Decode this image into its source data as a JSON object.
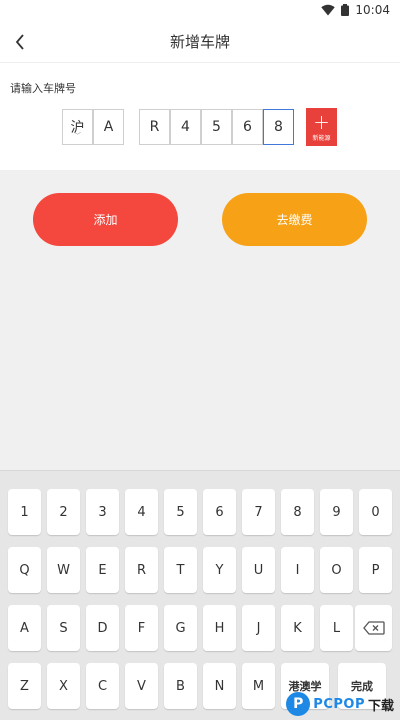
{
  "status_bar": {
    "time": "10:04"
  },
  "nav": {
    "title": "新增车牌"
  },
  "plate": {
    "prompt": "请输入车牌号",
    "province": "沪",
    "cells": [
      "A",
      "R",
      "4",
      "5",
      "6",
      "8"
    ],
    "new_energy_plus": "+",
    "new_energy_label": "新能源"
  },
  "actions": {
    "add_label": "添加",
    "pay_label": "去缴费"
  },
  "keyboard": {
    "row1": [
      "1",
      "2",
      "3",
      "4",
      "5",
      "6",
      "7",
      "8",
      "9",
      "0"
    ],
    "row2": [
      "Q",
      "W",
      "E",
      "R",
      "T",
      "Y",
      "U",
      "I",
      "O",
      "P"
    ],
    "row3": [
      "A",
      "S",
      "D",
      "F",
      "G",
      "H",
      "J",
      "K",
      "L"
    ],
    "row4": [
      "Z",
      "X",
      "C",
      "V",
      "B",
      "N",
      "M"
    ],
    "mode_label": "港澳学",
    "done_label": "完成"
  },
  "watermark": {
    "brand": "PCPOP",
    "suffix": "下载"
  },
  "colors": {
    "add": "#f4473d",
    "pay": "#f7a116",
    "new_energy": "#e8403a",
    "active_border": "#3f78d8"
  }
}
